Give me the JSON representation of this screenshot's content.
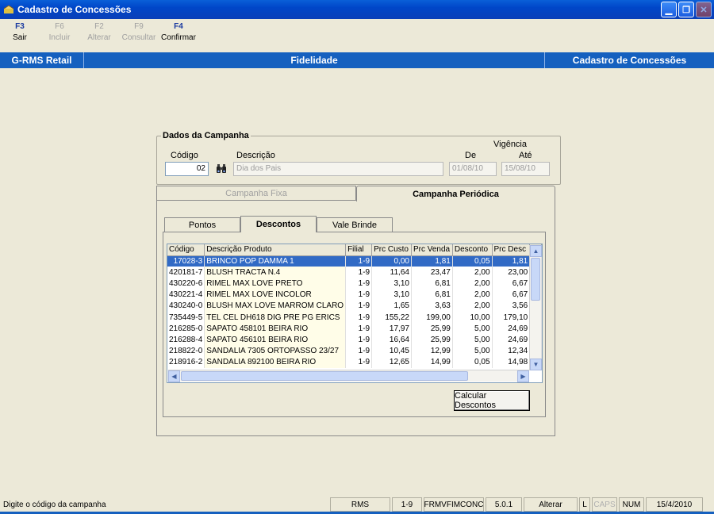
{
  "window": {
    "title": "Cadastro de Concessões"
  },
  "toolbar": [
    {
      "key": "F3",
      "label": "Sair",
      "enabled": true
    },
    {
      "key": "F6",
      "label": "Incluir",
      "enabled": false
    },
    {
      "key": "F2",
      "label": "Alterar",
      "enabled": false
    },
    {
      "key": "F9",
      "label": "Consultar",
      "enabled": false
    },
    {
      "key": "F4",
      "label": "Confirmar",
      "enabled": true
    }
  ],
  "header_bar": {
    "left": "G-RMS Retail",
    "center": "Fidelidade",
    "right": "Cadastro de Concessões"
  },
  "campanha": {
    "group_title": "Dados da Campanha",
    "codigo_label": "Código",
    "codigo_value": "02",
    "descricao_label": "Descrição",
    "descricao_value": "Dia dos Pais",
    "vigencia_label": "Vigência",
    "de_label": "De",
    "de_value": "01/08/10",
    "ate_label": "Até",
    "ate_value": "15/08/10"
  },
  "outer_tabs": {
    "fixa": "Campanha Fixa",
    "periodica": "Campanha Periódica",
    "active": "periodica"
  },
  "inner_tabs": {
    "pontos": "Pontos",
    "descontos": "Descontos",
    "vale": "Vale Brinde",
    "active": "descontos"
  },
  "grid": {
    "columns": [
      "Código",
      "Descrição Produto",
      "Filial",
      "Prc Custo",
      "Prc Venda",
      "Desconto",
      "Prc Desc"
    ],
    "rows": [
      [
        "17028-3",
        "BRINCO POP DAMMA    1",
        "1-9",
        "0,00",
        "1,81",
        "0,05",
        "1,81"
      ],
      [
        "420181-7",
        "BLUSH TRACTA N.4",
        "1-9",
        "11,64",
        "23,47",
        "2,00",
        "23,00"
      ],
      [
        "430220-6",
        "RIMEL MAX LOVE PRETO",
        "1-9",
        "3,10",
        "6,81",
        "2,00",
        "6,67"
      ],
      [
        "430221-4",
        "RIMEL MAX LOVE INCOLOR",
        "1-9",
        "3,10",
        "6,81",
        "2,00",
        "6,67"
      ],
      [
        "430240-0",
        "BLUSH MAX LOVE MARROM CLARO",
        "1-9",
        "1,65",
        "3,63",
        "2,00",
        "3,56"
      ],
      [
        "735449-5",
        "TEL CEL DH618 DIG PRE PG ERICS",
        "1-9",
        "155,22",
        "199,00",
        "10,00",
        "179,10"
      ],
      [
        "216285-0",
        "SAPATO 458101 BEIRA RIO",
        "1-9",
        "17,97",
        "25,99",
        "5,00",
        "24,69"
      ],
      [
        "216288-4",
        "SAPATO 456101 BEIRA RIO",
        "1-9",
        "16,64",
        "25,99",
        "5,00",
        "24,69"
      ],
      [
        "218822-0",
        "SANDALIA 7305 ORTOPASSO 23/27",
        "1-9",
        "10,45",
        "12,99",
        "5,00",
        "12,34"
      ],
      [
        "218916-2",
        "SANDALIA 892100 BEIRA RIO",
        "1-9",
        "12,65",
        "14,99",
        "0,05",
        "14,98"
      ]
    ],
    "selected_row": 0
  },
  "calc_button": "Calcular Descontos",
  "status": {
    "message": "Digite o código da campanha",
    "system": "RMS",
    "filial": "1-9",
    "form": "FRMVFIMCONC",
    "version": "5.0.1",
    "mode": "Alterar",
    "l": "L",
    "caps": "CAPS",
    "num": "NUM",
    "date": "15/4/2010"
  },
  "colors": {
    "titlebar": "#0046c8",
    "header_bar": "#1560bf",
    "selection": "#316ac5"
  }
}
